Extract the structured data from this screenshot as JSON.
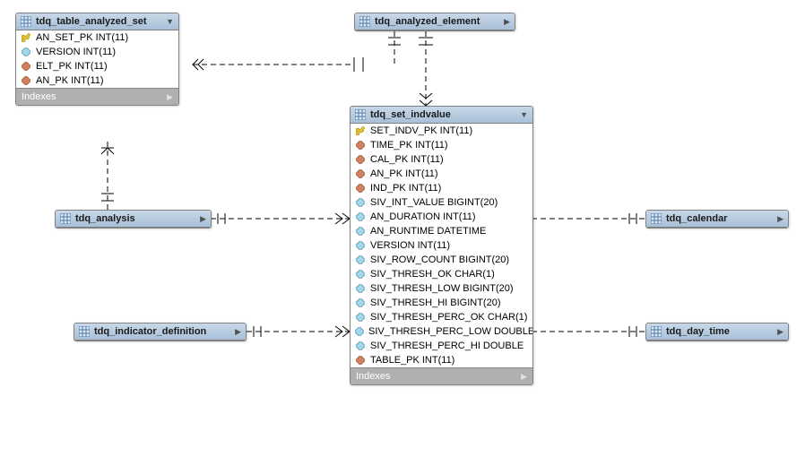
{
  "labels": {
    "indexes": "Indexes"
  },
  "entities": {
    "table_analyzed_set": {
      "title": "tdq_table_analyzed_set",
      "columns": [
        {
          "icon": "pk",
          "text": "AN_SET_PK INT(11)"
        },
        {
          "icon": "field",
          "text": "VERSION INT(11)"
        },
        {
          "icon": "fk",
          "text": "ELT_PK INT(11)"
        },
        {
          "icon": "fk",
          "text": "AN_PK INT(11)"
        }
      ],
      "indexes": true
    },
    "analyzed_element": {
      "title": "tdq_analyzed_element",
      "columns": [],
      "indexes": false
    },
    "analysis": {
      "title": "tdq_analysis",
      "columns": [],
      "indexes": false
    },
    "calendar": {
      "title": "tdq_calendar",
      "columns": [],
      "indexes": false
    },
    "indicator_definition": {
      "title": "tdq_indicator_definition",
      "columns": [],
      "indexes": false
    },
    "day_time": {
      "title": "tdq_day_time",
      "columns": [],
      "indexes": false
    },
    "set_indvalue": {
      "title": "tdq_set_indvalue",
      "columns": [
        {
          "icon": "pk",
          "text": "SET_INDV_PK INT(11)"
        },
        {
          "icon": "fk",
          "text": "TIME_PK INT(11)"
        },
        {
          "icon": "fk",
          "text": "CAL_PK INT(11)"
        },
        {
          "icon": "fk",
          "text": "AN_PK INT(11)"
        },
        {
          "icon": "fk",
          "text": "IND_PK INT(11)"
        },
        {
          "icon": "field",
          "text": "SIV_INT_VALUE BIGINT(20)"
        },
        {
          "icon": "field",
          "text": "AN_DURATION INT(11)"
        },
        {
          "icon": "field",
          "text": "AN_RUNTIME DATETIME"
        },
        {
          "icon": "field",
          "text": "VERSION INT(11)"
        },
        {
          "icon": "field",
          "text": "SIV_ROW_COUNT BIGINT(20)"
        },
        {
          "icon": "field",
          "text": "SIV_THRESH_OK CHAR(1)"
        },
        {
          "icon": "field",
          "text": "SIV_THRESH_LOW BIGINT(20)"
        },
        {
          "icon": "field",
          "text": "SIV_THRESH_HI BIGINT(20)"
        },
        {
          "icon": "field",
          "text": "SIV_THRESH_PERC_OK CHAR(1)"
        },
        {
          "icon": "field",
          "text": "SIV_THRESH_PERC_LOW DOUBLE"
        },
        {
          "icon": "field",
          "text": "SIV_THRESH_PERC_HI DOUBLE"
        },
        {
          "icon": "fk",
          "text": "TABLE_PK INT(11)"
        }
      ],
      "indexes": true
    }
  }
}
